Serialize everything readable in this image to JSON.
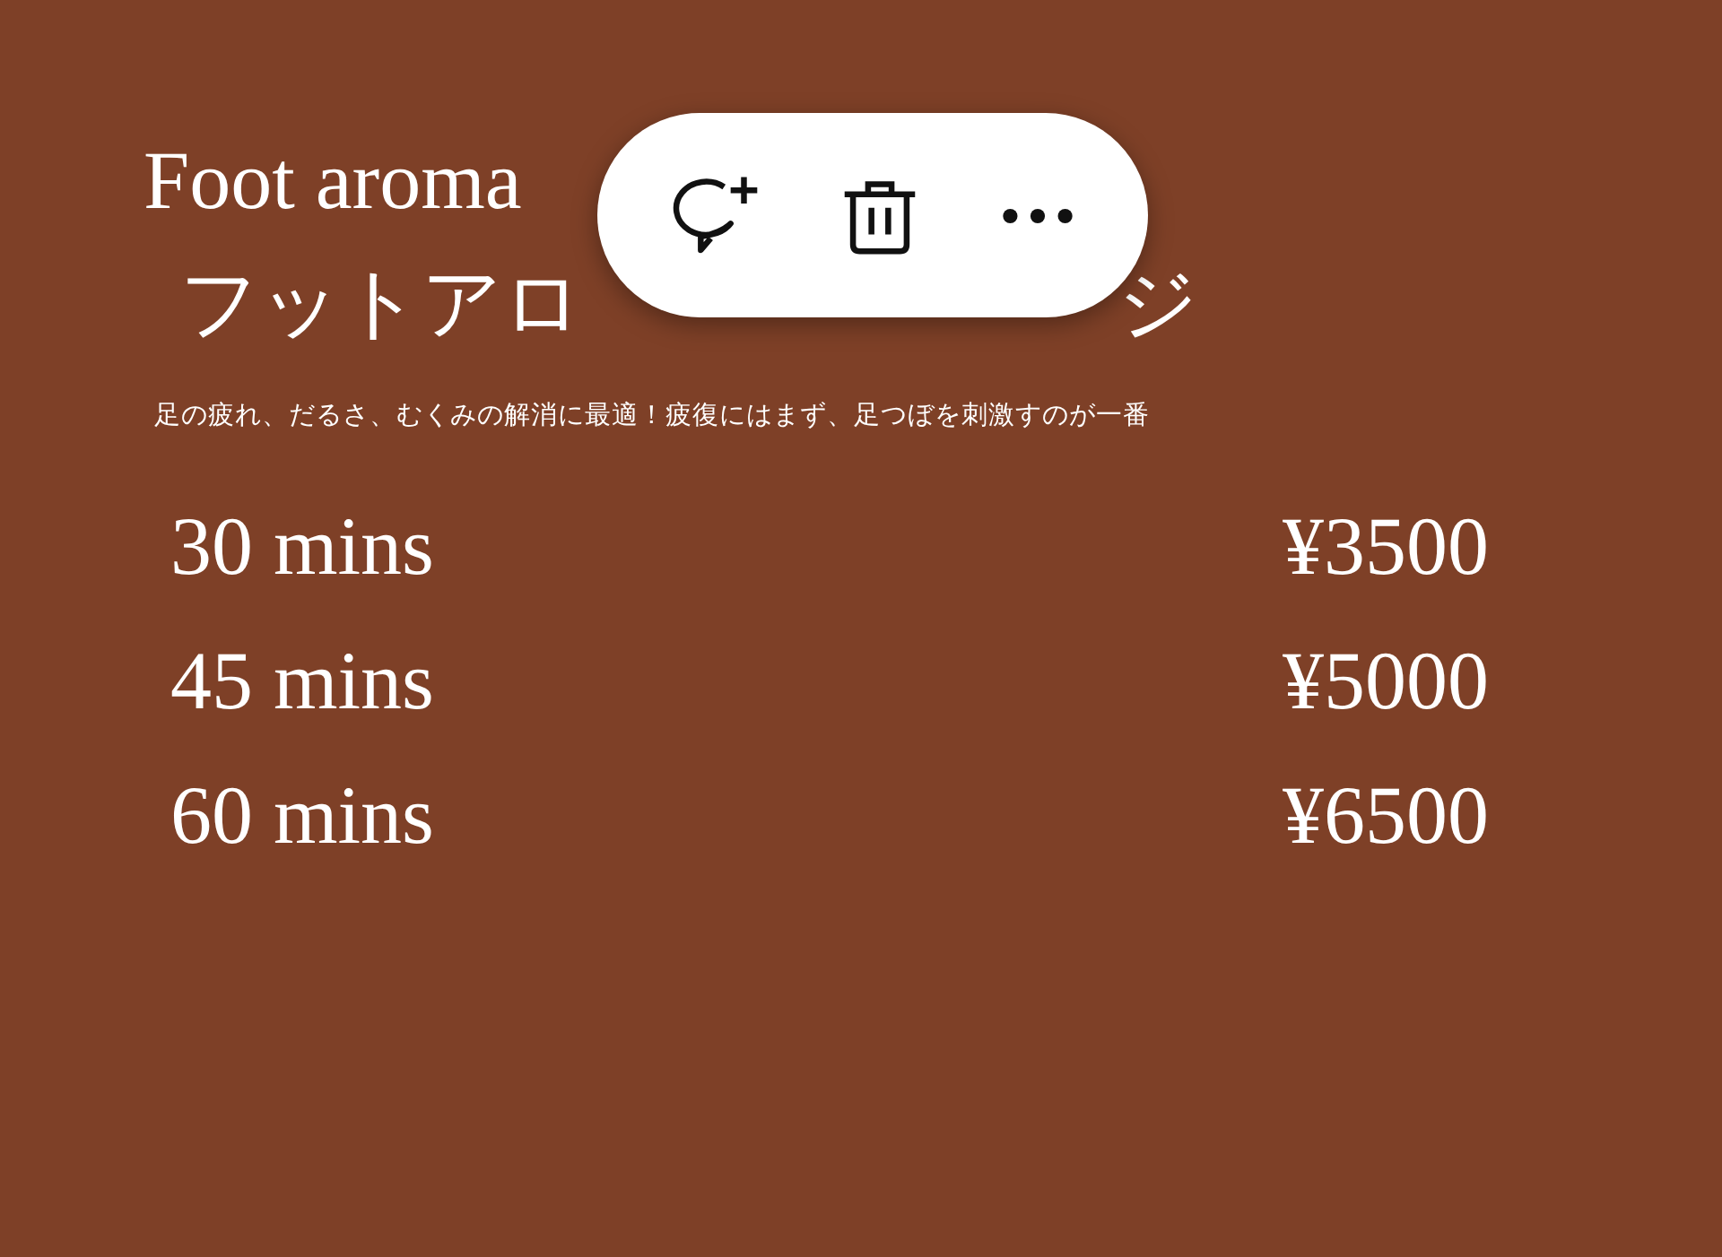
{
  "slide": {
    "title": "Foot aroma",
    "subtitle_start": "フットアロ",
    "subtitle_end": "ジ",
    "description": "足の疲れ、だるさ、むくみの解消に最適！疲復にはまず、足つぼを刺激すのが一番",
    "prices": [
      {
        "duration": "30 mins",
        "price": "¥3500"
      },
      {
        "duration": "45 mins",
        "price": "¥5000"
      },
      {
        "duration": "60 mins",
        "price": "¥6500"
      }
    ]
  },
  "toolbar": {
    "buttons": [
      {
        "kind": "comment"
      },
      {
        "kind": "delete"
      },
      {
        "kind": "more"
      }
    ]
  }
}
